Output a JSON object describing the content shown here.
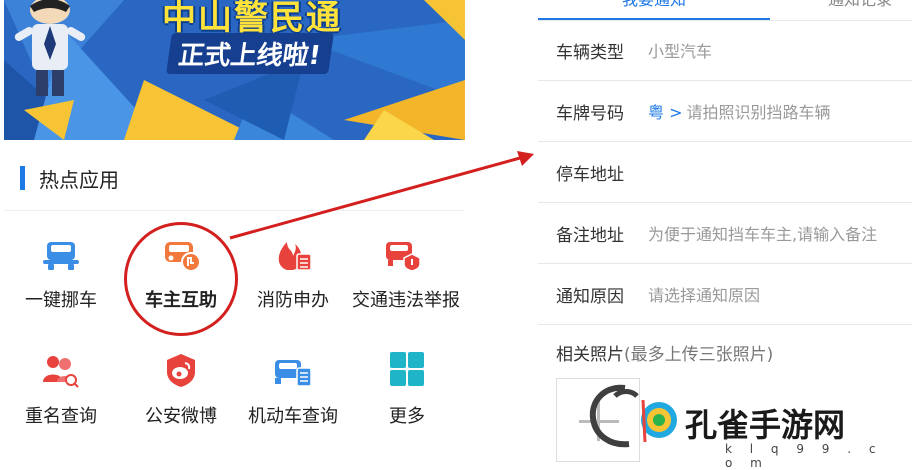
{
  "banner": {
    "title": "中山警民通",
    "subtitle": "正式上线啦!"
  },
  "hot_apps": {
    "section_title": "热点应用",
    "items": [
      {
        "label": "一键挪车",
        "icon": "car-move-icon",
        "color": "#3a8ee6"
      },
      {
        "label": "车主互助",
        "icon": "car-owner-help-icon",
        "color": "#f2783c"
      },
      {
        "label": "消防申办",
        "icon": "fire-apply-icon",
        "color": "#e8423c"
      },
      {
        "label": "交通违法举报",
        "icon": "traffic-violation-report-icon",
        "color": "#e8423c"
      },
      {
        "label": "重名查询",
        "icon": "name-search-icon",
        "color": "#e8423c"
      },
      {
        "label": "公安微博",
        "icon": "weibo-icon",
        "color": "#e8423c"
      },
      {
        "label": "机动车查询",
        "icon": "vehicle-query-icon",
        "color": "#3a8ee6"
      },
      {
        "label": "更多",
        "icon": "more-grid-icon",
        "color": "#1fb4c8"
      }
    ]
  },
  "form": {
    "tabs": [
      "我要通知",
      "通知记录"
    ],
    "fields": [
      {
        "label": "车辆类型",
        "value": "小型汽车"
      },
      {
        "label": "车牌号码",
        "prefix": "粤 >",
        "value": "请拍照识别挡路车辆"
      },
      {
        "label": "停车地址",
        "value": ""
      },
      {
        "label": "备注地址",
        "value": "为便于通知挡车车主,请输入备注"
      },
      {
        "label": "通知原因",
        "value": "请选择通知原因"
      }
    ],
    "photos_label": "相关照片",
    "photos_hint": "(最多上传三张照片)"
  },
  "watermark": {
    "text": "孔雀手游网",
    "sub": "k l q 9 9 . c o m"
  },
  "colors": {
    "accent": "#1d79e6",
    "highlight": "#d41f1f"
  }
}
